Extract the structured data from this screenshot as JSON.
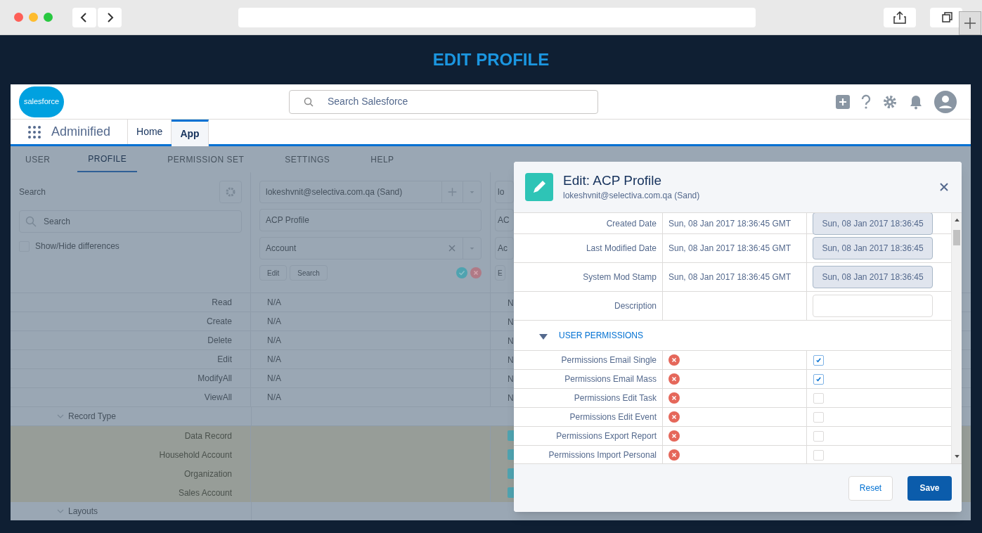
{
  "page_title": "EDIT PROFILE",
  "header": {
    "logo": "salesforce",
    "search_placeholder": "Search Salesforce"
  },
  "nav": {
    "app_name": "Adminified",
    "tabs": [
      {
        "label": "Home",
        "selected": false
      },
      {
        "label": "App",
        "selected": true
      }
    ]
  },
  "tabs": [
    {
      "label": "USER",
      "selected": false
    },
    {
      "label": "PROFILE",
      "selected": true
    },
    {
      "label": "PERMISSION SET",
      "selected": false
    },
    {
      "label": "SETTINGS",
      "selected": false
    },
    {
      "label": "HELP",
      "selected": false
    }
  ],
  "left_panel": {
    "search_label": "Search",
    "search_placeholder": "Search",
    "toggle": {
      "label": "Show/Hide differences",
      "checked": false
    }
  },
  "columns": [
    {
      "org": "lokeshvnit@selectiva.com.qa (Sand)",
      "profile": "ACP Profile",
      "object": "Account",
      "buttons": [
        "Edit",
        "Search"
      ],
      "status_icons": true
    },
    {
      "org": "lo",
      "profile": "AC",
      "object": "Ac",
      "buttons": [
        "E"
      ]
    }
  ],
  "rows": [
    {
      "kind": "field",
      "label": "Read",
      "values": [
        "N/A",
        "N"
      ]
    },
    {
      "kind": "field",
      "label": "Create",
      "values": [
        "N/A",
        "N"
      ]
    },
    {
      "kind": "field",
      "label": "Delete",
      "values": [
        "N/A",
        "N"
      ]
    },
    {
      "kind": "field",
      "label": "Edit",
      "values": [
        "N/A",
        "N"
      ]
    },
    {
      "kind": "field",
      "label": "ModifyAll",
      "values": [
        "N/A",
        "N"
      ]
    },
    {
      "kind": "field",
      "label": "ViewAll",
      "values": [
        "N/A",
        "N"
      ]
    },
    {
      "kind": "group",
      "label": "Record Type",
      "expanded": true
    },
    {
      "kind": "record_type",
      "label": "Data Record",
      "checked": true
    },
    {
      "kind": "record_type",
      "label": "Household Account",
      "checked": true
    },
    {
      "kind": "record_type",
      "label": "Organization",
      "checked": true
    },
    {
      "kind": "record_type",
      "label": "Sales Account",
      "checked": true
    },
    {
      "kind": "group",
      "label": "Layouts",
      "expanded": true
    }
  ],
  "modal": {
    "title": "Edit: ACP Profile",
    "subtitle": "lokeshvnit@selectiva.com.qa (Sand)",
    "fields": [
      {
        "label": "Created Date",
        "current": "Sun, 08 Jan 2017 18:36:45 GMT",
        "value": "Sun, 08 Jan 2017 18:36:45",
        "disabled": true
      },
      {
        "label": "Last Modified Date",
        "current": "Sun, 08 Jan 2017 18:36:45 GMT",
        "value": "Sun, 08 Jan 2017 18:36:45",
        "disabled": true
      },
      {
        "label": "System Mod Stamp",
        "current": "Sun, 08 Jan 2017 18:36:45 GMT",
        "value": "Sun, 08 Jan 2017 18:36:45",
        "disabled": true
      },
      {
        "label": "Description",
        "disabled": false
      }
    ],
    "section": {
      "label": "USER PERMISSIONS",
      "expanded": true
    },
    "permissions": [
      {
        "label": "Permissions Email Single",
        "current": false,
        "checked": true
      },
      {
        "label": "Permissions Email Mass",
        "current": false,
        "checked": true
      },
      {
        "label": "Permissions Edit Task",
        "current": false,
        "checked": false
      },
      {
        "label": "Permissions Edit Event",
        "current": false,
        "checked": false
      },
      {
        "label": "Permissions Export Report",
        "current": false,
        "checked": false
      },
      {
        "label": "Permissions Import Personal",
        "current": false,
        "checked": false
      }
    ],
    "buttons": [
      {
        "label": "Reset",
        "kind": "neutral"
      },
      {
        "label": "Save",
        "kind": "brand"
      }
    ]
  }
}
